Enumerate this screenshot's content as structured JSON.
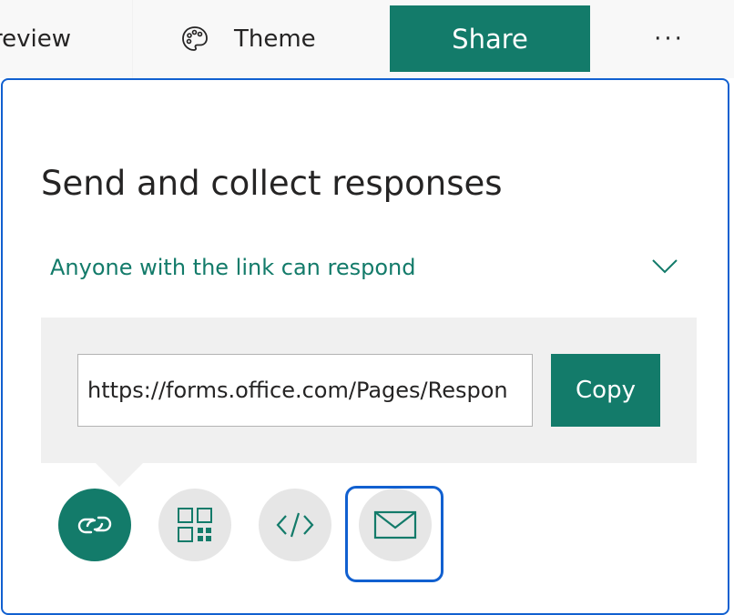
{
  "topbar": {
    "preview_label": "review",
    "theme_label": "Theme",
    "share_label": "Share",
    "more_label": "···"
  },
  "panel": {
    "title": "Send and collect responses",
    "permission_label": "Anyone with the link can respond",
    "url_value": "https://forms.office.com/Pages/Respon",
    "copy_label": "Copy"
  },
  "share_options": [
    {
      "name": "link-icon",
      "selected": true
    },
    {
      "name": "qr-code-icon",
      "selected": false
    },
    {
      "name": "embed-code-icon",
      "selected": false
    },
    {
      "name": "email-icon",
      "selected": false,
      "focused": true
    }
  ],
  "colors": {
    "accent": "#137b6a",
    "focus": "#1160d0",
    "text": "#252424",
    "icon_bg": "#e6e6e6",
    "link_box_bg": "#f0f0f0"
  }
}
